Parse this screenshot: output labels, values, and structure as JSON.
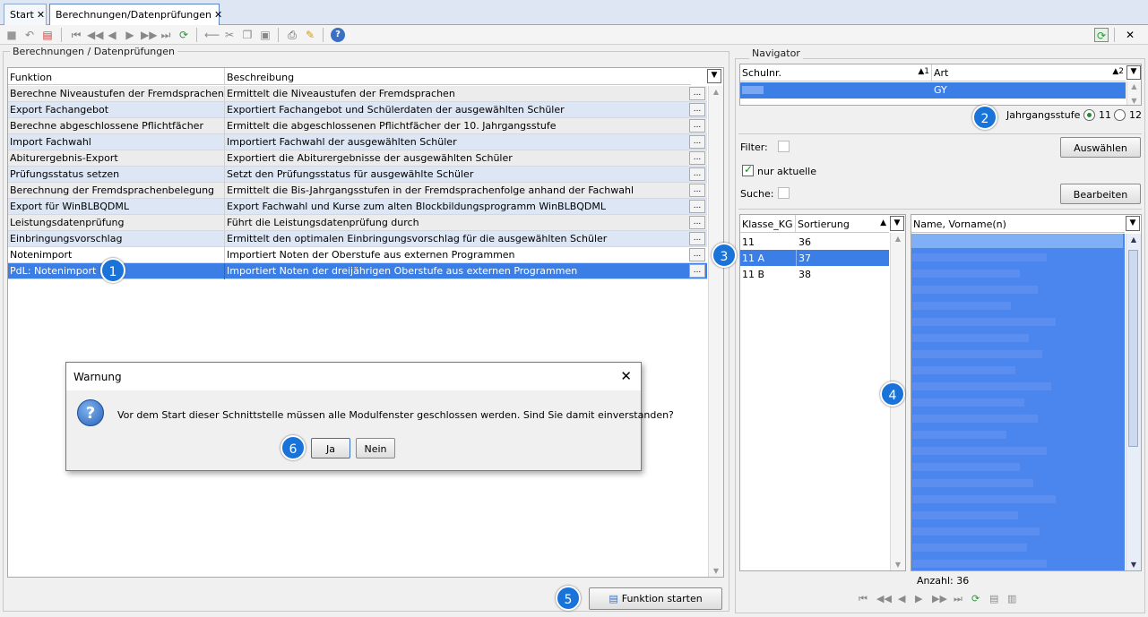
{
  "tabs": [
    {
      "label": "Start"
    },
    {
      "label": "Berechnungen/Datenprüfungen"
    }
  ],
  "close_glyph": "✕",
  "left_panel": {
    "legend": "Berechnungen / Datenprüfungen",
    "headers": {
      "funktion": "Funktion",
      "beschreibung": "Beschreibung"
    },
    "rows": [
      {
        "funktion": "Berechne Niveaustufen der Fremdsprachen",
        "beschreibung": "Ermittelt die Niveaustufen der Fremdsprachen"
      },
      {
        "funktion": "Export Fachangebot",
        "beschreibung": "Exportiert Fachangebot und Schülerdaten der ausgewählten Schüler"
      },
      {
        "funktion": "Berechne abgeschlossene Pflichtfächer",
        "beschreibung": "Ermittelt die abgeschlossenen Pflichtfächer der 10. Jahrgangsstufe"
      },
      {
        "funktion": "Import Fachwahl",
        "beschreibung": "Importiert Fachwahl der ausgewählten Schüler"
      },
      {
        "funktion": "Abiturergebnis-Export",
        "beschreibung": "Exportiert die Abiturergebnisse der ausgewählten Schüler"
      },
      {
        "funktion": "Prüfungsstatus setzen",
        "beschreibung": "Setzt den Prüfungsstatus für ausgewählte Schüler"
      },
      {
        "funktion": "Berechnung der Fremdsprachenbelegung",
        "beschreibung": "Ermittelt die Bis-Jahrgangsstufen in der Fremdsprachenfolge anhand der Fachwahl"
      },
      {
        "funktion": "Export für WinBLBQDML",
        "beschreibung": "Export Fachwahl und Kurse zum alten Blockbildungsprogramm WinBLBQDML"
      },
      {
        "funktion": "Leistungsdatenprüfung",
        "beschreibung": "Führt die Leistungsdatenprüfung durch"
      },
      {
        "funktion": "Einbringungsvorschlag",
        "beschreibung": "Ermittelt den optimalen Einbringungsvorschlag für die ausgewählten Schüler"
      },
      {
        "funktion": "Notenimport",
        "beschreibung": "Importiert Noten der Oberstufe aus externen Programmen"
      },
      {
        "funktion": "PdL: Notenimport",
        "beschreibung": "Importiert Noten der dreijährigen Oberstufe aus externen Programmen"
      }
    ],
    "dots_label": "...",
    "start_button": "Funktion starten"
  },
  "navigator": {
    "legend": "Navigator",
    "headers": {
      "schulnr": "Schulnr.",
      "schulnr_sort": "1",
      "art": "Art",
      "art_sort": "2"
    },
    "row": {
      "art": "GY"
    },
    "jahrgangsstufe_label": "Jahrgangsstufe",
    "option_11": "11",
    "option_12": "12",
    "filter_label": "Filter:",
    "nur_aktuelle_label": "nur aktuelle",
    "suche_label": "Suche:",
    "auswaehlen_button": "Auswählen",
    "bearbeiten_button": "Bearbeiten",
    "klassen_headers": {
      "klasse": "Klasse_KG",
      "sortierung": "Sortierung"
    },
    "klassen": [
      {
        "klasse": "11",
        "sortierung": "36"
      },
      {
        "klasse": "11 A",
        "sortierung": "37"
      },
      {
        "klasse": "11 B",
        "sortierung": "38"
      }
    ],
    "schueler_header": "Name, Vorname(n)",
    "anzahl_label": "Anzahl: 36"
  },
  "dialog": {
    "title": "Warnung",
    "message": "Vor dem Start dieser Schnittstelle müssen alle Modulfenster geschlossen werden. Sind Sie damit einverstanden?",
    "ja": "Ja",
    "nein": "Nein"
  },
  "badges": [
    "1",
    "2",
    "3",
    "4",
    "5",
    "6"
  ],
  "colors": {
    "selection": "#3b7fe6",
    "badge": "#1a73d9",
    "alt_row": "#dce6f4"
  }
}
